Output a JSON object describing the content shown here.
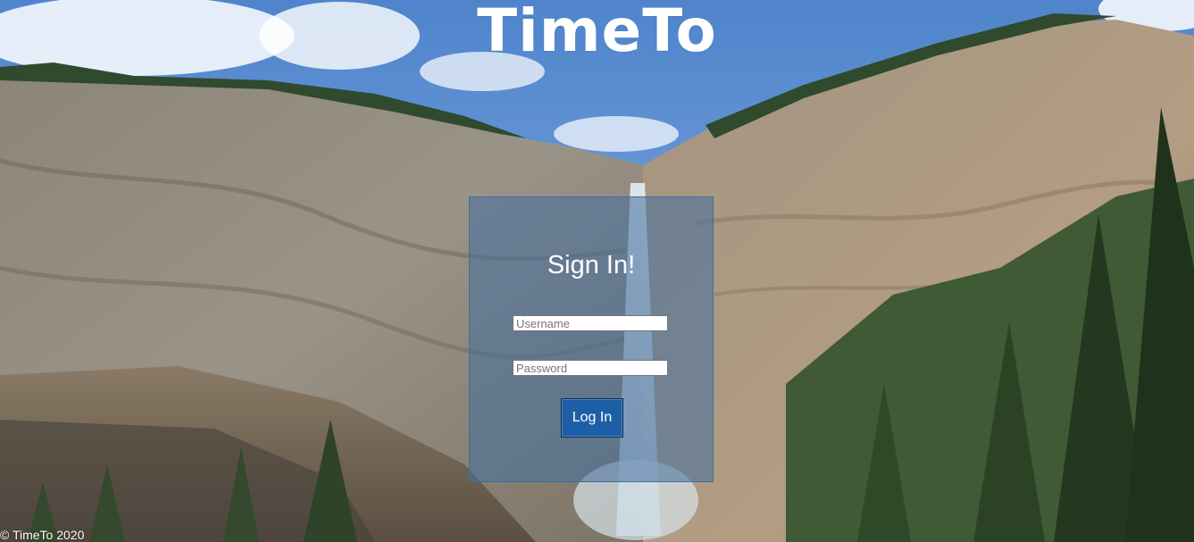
{
  "app": {
    "logo_text": "TimeTo"
  },
  "login": {
    "title": "Sign In!",
    "username_placeholder": "Username",
    "username_value": "",
    "password_placeholder": "Password",
    "password_value": "",
    "login_label": "Log In"
  },
  "footer": {
    "copyright": "© TimeTo 2020"
  },
  "colors": {
    "sky": "#5f90d2",
    "panel": "#4470a0",
    "button": "#1c5fa6",
    "text": "#ffffff"
  },
  "background": {
    "scene": "mountain cliffs with waterfall and pine trees"
  }
}
